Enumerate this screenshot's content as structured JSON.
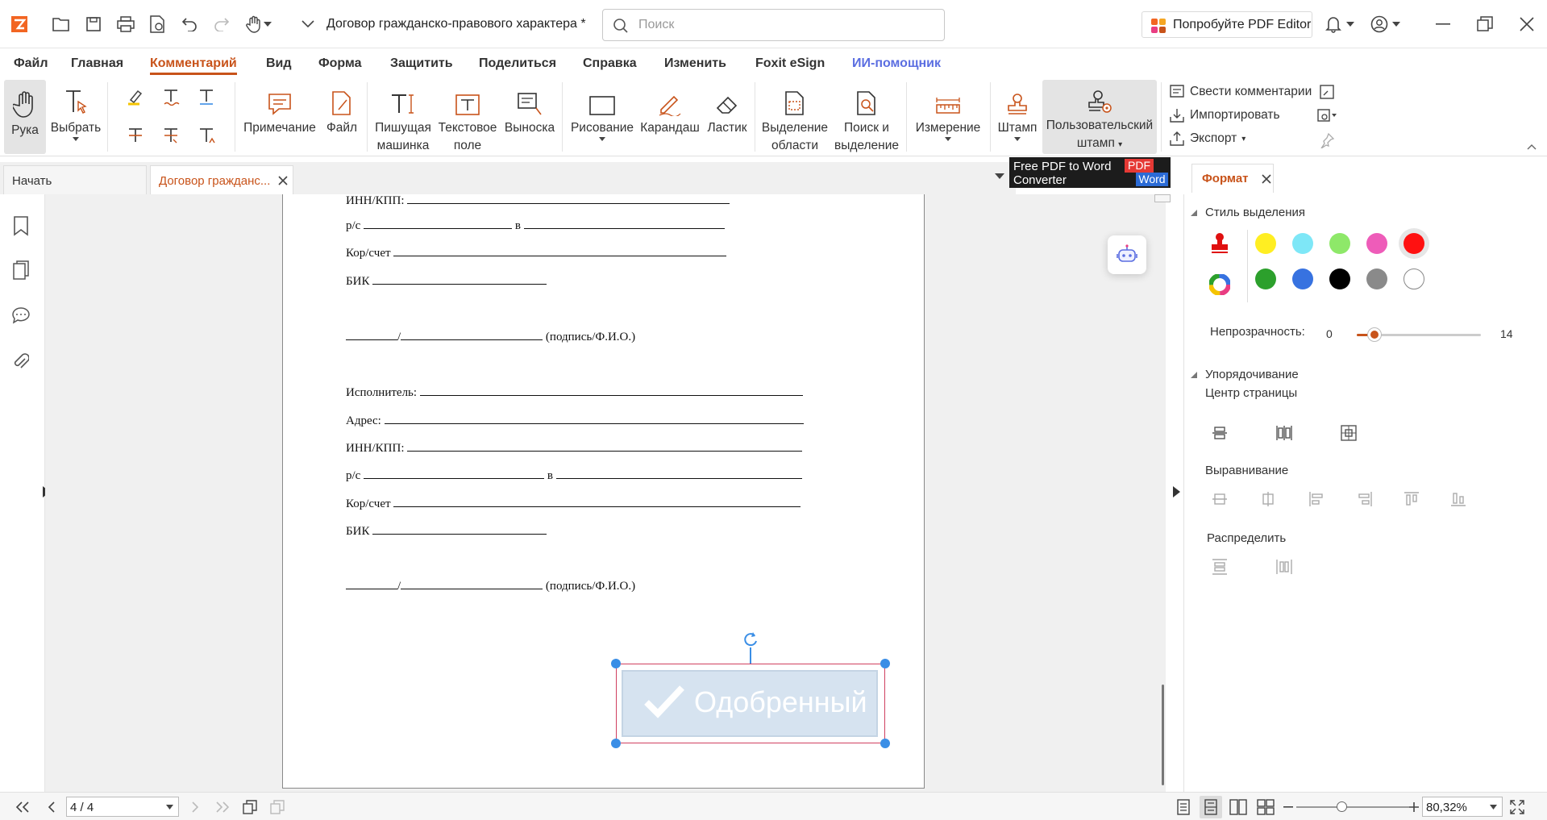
{
  "window": {
    "doc_title": "Договор гражданско-правового характера *",
    "search_placeholder": "Поиск",
    "try_button": "Попробуйте PDF Editor"
  },
  "menu": [
    "Файл",
    "Главная",
    "Комментарий",
    "Вид",
    "Форма",
    "Защитить",
    "Поделиться",
    "Справка",
    "Изменить",
    "Foxit eSign",
    "ИИ-помощник"
  ],
  "ribbon": {
    "hand": "Рука",
    "select": "Выбрать",
    "note": "Примечание",
    "file": "Файл",
    "typewriter_1": "Пишущая",
    "typewriter_2": "машинка",
    "textbox_1": "Текстовое",
    "textbox_2": "поле",
    "callout": "Выноска",
    "drawing": "Рисование",
    "pencil": "Карандаш",
    "eraser": "Ластик",
    "area_1": "Выделение",
    "area_2": "области",
    "search_1": "Поиск и",
    "search_2": "выделение",
    "measure": "Измерение",
    "stamp": "Штамп",
    "custom_stamp_1": "Пользовательский",
    "custom_stamp_2": "штамп",
    "summarize": "Свести комментарии",
    "import": "Импортировать",
    "export": "Экспорт"
  },
  "ad": {
    "line1": "Free PDF to Word",
    "line2": "Converter",
    "badge_pdf": "PDF",
    "badge_word": "Word"
  },
  "tabs": {
    "start": "Начать",
    "doc": "Договор гражданс...",
    "format": "Формат"
  },
  "document": {
    "inn": "ИНН/КПП:",
    "rs": "р/с",
    "in": "в",
    "kor": "Кор/счет",
    "bik": "БИК",
    "sign": "(подпись/Ф.И.О.)",
    "executor": "Исполнитель:",
    "address": "Адрес:",
    "stamp_text": "Одобренный"
  },
  "format_panel": {
    "style_head": "Стиль выделения",
    "opacity_label": "Непрозрачность:",
    "opacity_min": "0",
    "opacity_value": "14",
    "opacity_fraction": 0.14,
    "arrange_head": "Упорядочивание",
    "page_center": "Центр страницы",
    "align": "Выравнивание",
    "distribute": "Распределить",
    "colors_row1": [
      "#ffee22",
      "#7ee7f7",
      "#8ee869",
      "#ee5cb9",
      "#ff1111"
    ],
    "colors_row2": [
      "#2ca02c",
      "#3772e0",
      "#000000",
      "#8a8a8a",
      "#ffffff"
    ],
    "selected_color": "#ff1111"
  },
  "status": {
    "page": "4 / 4",
    "zoom": "80,32%"
  },
  "colors": {
    "accent": "#c8531a",
    "ai": "#5b6ee1",
    "selection": "#3a8ee6"
  }
}
